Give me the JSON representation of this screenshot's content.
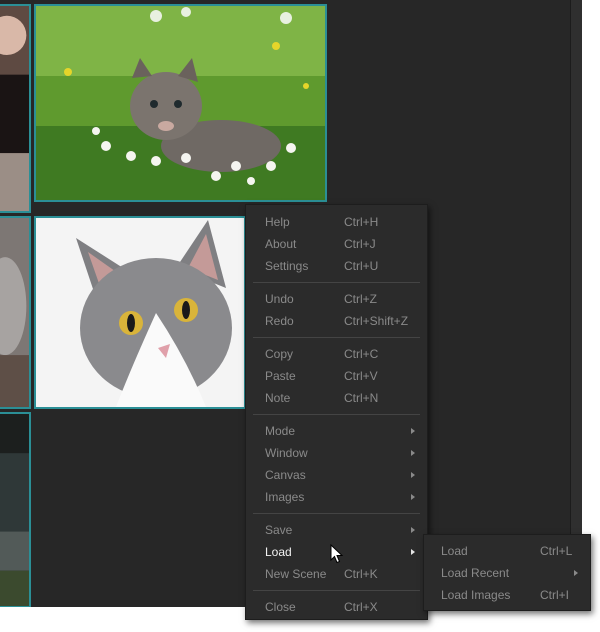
{
  "images": [
    {
      "name": "kitten-in-grass"
    },
    {
      "name": "gray-white-cat"
    }
  ],
  "context_menu": {
    "groups": [
      [
        {
          "label": "Help",
          "shortcut": "Ctrl+H"
        },
        {
          "label": "About",
          "shortcut": "Ctrl+J"
        },
        {
          "label": "Settings",
          "shortcut": "Ctrl+U"
        }
      ],
      [
        {
          "label": "Undo",
          "shortcut": "Ctrl+Z"
        },
        {
          "label": "Redo",
          "shortcut": "Ctrl+Shift+Z"
        }
      ],
      [
        {
          "label": "Copy",
          "shortcut": "Ctrl+C"
        },
        {
          "label": "Paste",
          "shortcut": "Ctrl+V"
        },
        {
          "label": "Note",
          "shortcut": "Ctrl+N"
        }
      ],
      [
        {
          "label": "Mode",
          "submenu": true
        },
        {
          "label": "Window",
          "submenu": true
        },
        {
          "label": "Canvas",
          "submenu": true
        },
        {
          "label": "Images",
          "submenu": true
        }
      ],
      [
        {
          "label": "Save",
          "submenu": true
        },
        {
          "label": "Load",
          "submenu": true,
          "active": true
        },
        {
          "label": "New Scene",
          "shortcut": "Ctrl+K"
        }
      ],
      [
        {
          "label": "Close",
          "shortcut": "Ctrl+X"
        }
      ]
    ]
  },
  "load_submenu": {
    "items": [
      {
        "label": "Load",
        "shortcut": "Ctrl+L"
      },
      {
        "label": "Load Recent",
        "submenu": true
      },
      {
        "label": "Load Images",
        "shortcut": "Ctrl+I"
      }
    ]
  },
  "colors": {
    "background": "#272727",
    "menu_bg": "#2b2b2b",
    "menu_text": "#8a8a8a",
    "menu_text_active": "#f2f2f2",
    "selection_border": "#2b8f96"
  }
}
